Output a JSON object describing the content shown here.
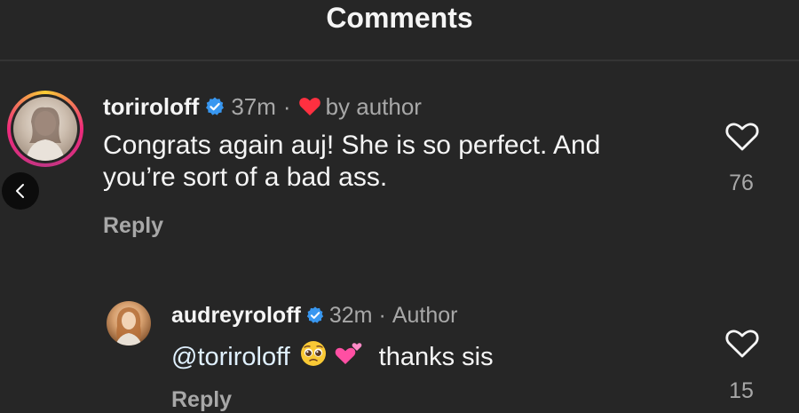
{
  "header": {
    "title": "Comments"
  },
  "comment": {
    "username": "toriroloff",
    "time": "37m",
    "separator": "·",
    "liked_by_author": "by author",
    "text_line1": "Congrats again auj! She is so perfect. And",
    "text_line2": "you’re sort of a bad ass.",
    "reply_label": "Reply",
    "like_count": "76"
  },
  "reply": {
    "username": "audreyroloff",
    "time": "32m",
    "separator": "·",
    "badge": "Author",
    "mention": "@toriroloff",
    "text_after_emoji": "thanks sis",
    "reply_label": "Reply",
    "like_count": "15"
  },
  "colors": {
    "background": "#262626",
    "verified_blue": "#3897f0",
    "heart_red": "#ff3040",
    "secondary_text": "#a8a8a8"
  },
  "icons": [
    "chevron-left-icon",
    "verified-badge-icon",
    "heart-filled-icon",
    "heart-outline-icon",
    "pleading-face-emoji-icon",
    "two-hearts-emoji-icon"
  ]
}
